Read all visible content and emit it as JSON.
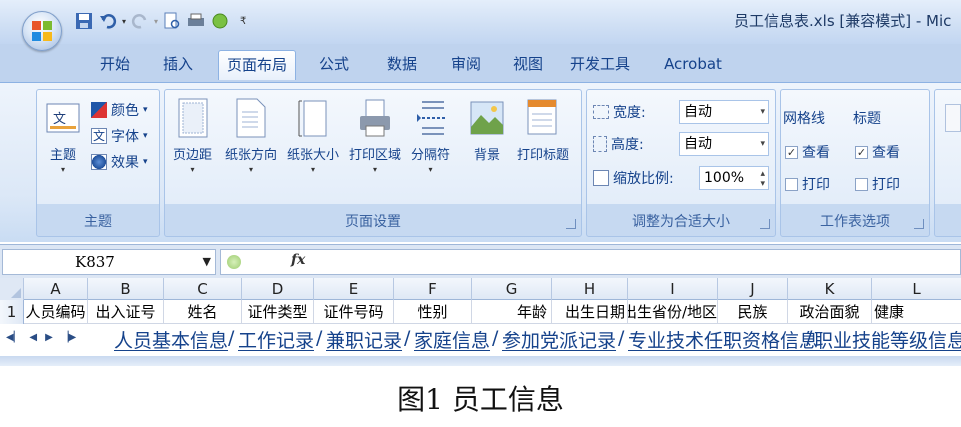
{
  "window": {
    "title": "员工信息表.xls  [兼容模式] - Mic"
  },
  "tabs": [
    {
      "label": "开始"
    },
    {
      "label": "插入"
    },
    {
      "label": "页面布局"
    },
    {
      "label": "公式"
    },
    {
      "label": "数据"
    },
    {
      "label": "审阅"
    },
    {
      "label": "视图"
    },
    {
      "label": "开发工具"
    },
    {
      "label": "Acrobat"
    }
  ],
  "ribbon": {
    "theme_group": {
      "label": "主题",
      "theme_button": "主题",
      "colors": "颜色",
      "fonts": "字体",
      "effects": "效果"
    },
    "page_setup_group": {
      "label": "页面设置",
      "margins": "页边距",
      "orientation": "纸张方向",
      "size": "纸张大小",
      "print_area": "打印区域",
      "breaks": "分隔符",
      "background": "背景",
      "print_titles": "打印标题"
    },
    "scale_group": {
      "label": "调整为合适大小",
      "width_label": "宽度:",
      "width_value": "自动",
      "height_label": "高度:",
      "height_value": "自动",
      "scale_label": "缩放比例:",
      "scale_value": "100%"
    },
    "sheet_options_group": {
      "label": "工作表选项",
      "gridlines": "网格线",
      "headings": "标题",
      "view": "查看",
      "print": "打印"
    }
  },
  "formula_bar": {
    "name_box": "K837",
    "fx": "fx",
    "value": ""
  },
  "grid": {
    "columns": [
      "A",
      "B",
      "C",
      "D",
      "E",
      "F",
      "G",
      "H",
      "I",
      "J",
      "K",
      "L"
    ],
    "row_number": "1",
    "row1": [
      "人员编码",
      "出入证号",
      "姓名",
      "证件类型",
      "证件号码",
      "性别",
      "年龄",
      "出生日期",
      "出生省份/地区",
      "民族",
      "政治面貌",
      "健康"
    ]
  },
  "sheets": [
    "人员基本信息",
    "工作记录",
    "兼职记录",
    "家庭信息",
    "参加党派记录",
    "专业技术任职资格信息",
    "职业技能等级信息"
  ],
  "caption": "图1  员工信息",
  "colors": {
    "ribbon_blue": "#dce8f7",
    "text_blue": "#15428b"
  }
}
